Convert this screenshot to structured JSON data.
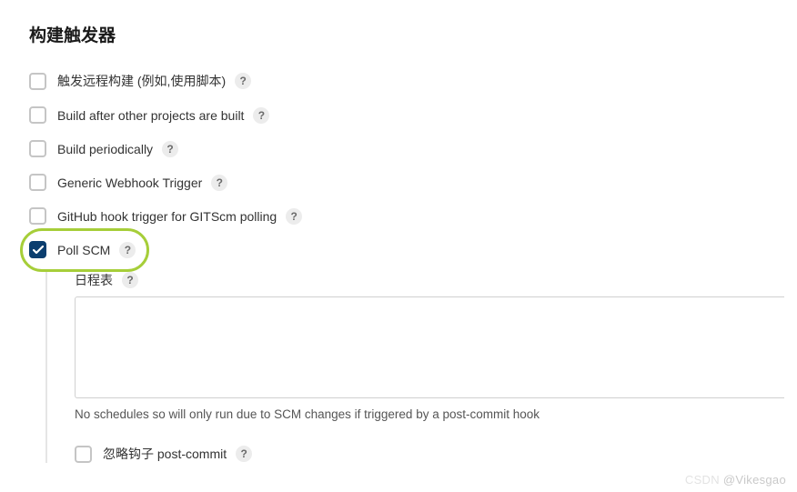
{
  "section": {
    "heading": "构建触发器"
  },
  "triggers": [
    {
      "label": "触发远程构建 (例如,使用脚本)",
      "checked": false,
      "help": true
    },
    {
      "label": "Build after other projects are built",
      "checked": false,
      "help": true
    },
    {
      "label": "Build periodically",
      "checked": false,
      "help": true
    },
    {
      "label": "Generic Webhook Trigger",
      "checked": false,
      "help": true
    },
    {
      "label": "GitHub hook trigger for GITScm polling",
      "checked": false,
      "help": true
    },
    {
      "label": "Poll SCM",
      "checked": true,
      "help": true
    }
  ],
  "schedule": {
    "label": "日程表",
    "value": "",
    "hint": "No schedules so will only run due to SCM changes if triggered by a post-commit hook"
  },
  "ignore_hook": {
    "label": "忽略钩子 post-commit",
    "checked": false
  },
  "help_glyph": "?",
  "watermark": {
    "left": "CSDN",
    "right": "@Vikesgao"
  }
}
